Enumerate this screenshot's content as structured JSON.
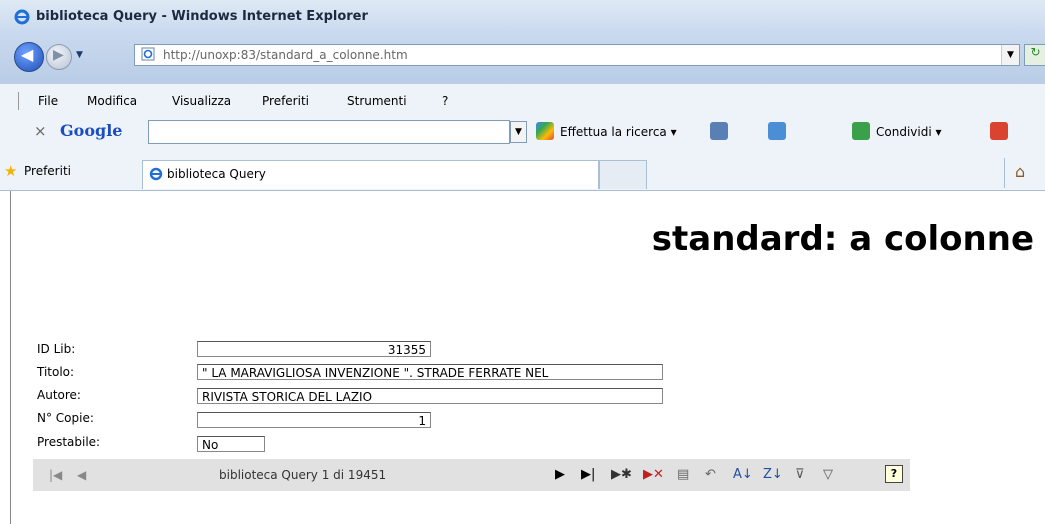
{
  "window": {
    "title": "biblioteca Query - Windows Internet Explorer"
  },
  "address": {
    "url_host": "http://unoxp",
    "url_rest": ":83/standard_a_colonne.htm"
  },
  "menu": {
    "items": [
      "File",
      "Modifica",
      "Visualizza",
      "Preferiti",
      "Strumenti",
      "?"
    ]
  },
  "google": {
    "logo": "Google",
    "search_label": "Effettua la ricerca ▾",
    "share_label": "Condividi ▾"
  },
  "favorites": {
    "label": "Preferiti"
  },
  "tab": {
    "label": "biblioteca Query"
  },
  "page": {
    "heading": "standard: a colonne",
    "fields": [
      {
        "label": "ID Lib:",
        "value": "31355"
      },
      {
        "label": "Titolo:",
        "value": "\" LA MARAVIGLIOSA INVENZIONE \". STRADE FERRATE NEL"
      },
      {
        "label": "Autore:",
        "value": "RIVISTA STORICA DEL LAZIO"
      },
      {
        "label": "N° Copie:",
        "value": "1"
      },
      {
        "label": "Prestabile:",
        "value": "No"
      }
    ],
    "record_nav": {
      "text": "biblioteca Query 1 di 19451"
    }
  }
}
